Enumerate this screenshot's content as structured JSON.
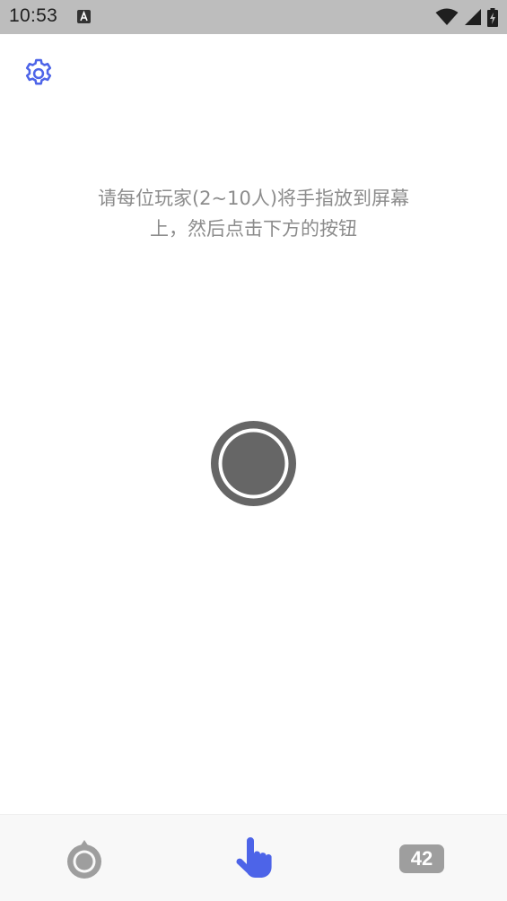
{
  "status_bar": {
    "time": "10:53",
    "icons": [
      "a-badge-icon",
      "wifi-icon",
      "cellular-signal-icon",
      "battery-charging-icon"
    ]
  },
  "settings": {
    "icon": "gear-icon"
  },
  "instruction": {
    "line1": "请每位玩家(2~10人)将手指放到屏幕",
    "line2": "上，然后点击下方的按钮"
  },
  "start_button": {
    "icon": "record-circle-icon"
  },
  "bottom_nav": {
    "items": [
      {
        "icon": "circle-indicator-icon",
        "active": false
      },
      {
        "icon": "pointing-hand-icon",
        "active": true
      },
      {
        "icon": "count-badge",
        "label": "42",
        "active": false
      }
    ]
  },
  "colors": {
    "accent": "#4d64e8",
    "inactive": "#9e9e9e",
    "text_secondary": "#8c8c8c",
    "status_bar": "#bdbdbd",
    "button_dark": "#666666"
  }
}
